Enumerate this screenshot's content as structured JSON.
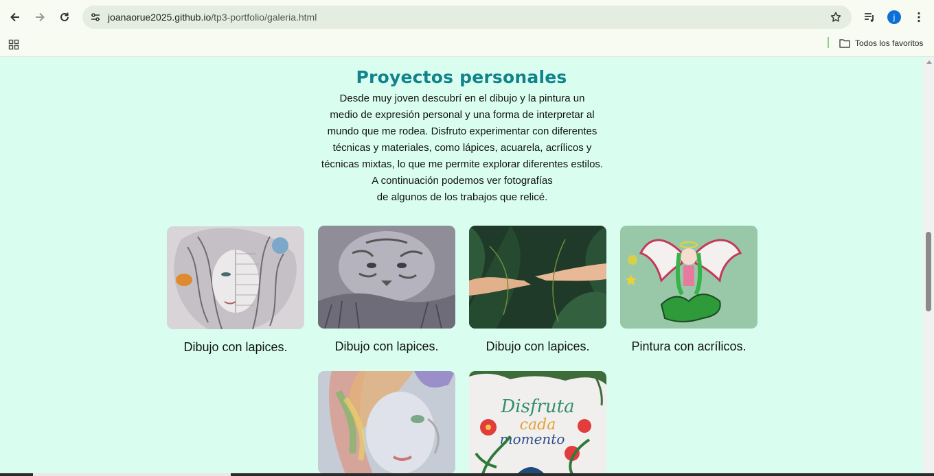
{
  "browser": {
    "url_domain": "joanaorue2025.github.io",
    "url_path": "/tp3-portfolio/galeria.html",
    "profile_initial": "j",
    "bookmarks_folder": "Todos los favoritos",
    "icons": [
      "back-arrow-icon",
      "forward-arrow-icon",
      "reload-icon",
      "site-info-icon",
      "star-icon",
      "media-controls-icon",
      "more-vert-icon",
      "apps-grid-icon",
      "folder-icon"
    ]
  },
  "page": {
    "title": "Proyectos personales",
    "intro_lines": [
      "Desde muy joven descubrí en el dibujo y la pintura un",
      "medio de expresión personal y una forma de interpretar al",
      "mundo que me rodea. Disfruto experimentar con diferentes",
      "técnicas y materiales, como lápices, acuarela, acrílicos y",
      "técnicas mixtas, lo que me permite explorar diferentes estilos.",
      "A continuación podemos ver fotografías",
      "de algunos de los trabajos que relicé."
    ],
    "gallery": [
      {
        "caption": "Dibujo con lapices."
      },
      {
        "caption": "Dibujo con lapices."
      },
      {
        "caption": "Dibujo con lapices."
      },
      {
        "caption": "Pintura con acrílicos."
      },
      {
        "caption": ""
      },
      {
        "caption": "",
        "artwork_text": [
          "Disfruta",
          "cada",
          "momento"
        ]
      }
    ]
  },
  "colors": {
    "page_background": "#d9fef0",
    "title": "#12838c",
    "chrome": "#f7fbf1",
    "omnibox": "#e5ede0"
  }
}
